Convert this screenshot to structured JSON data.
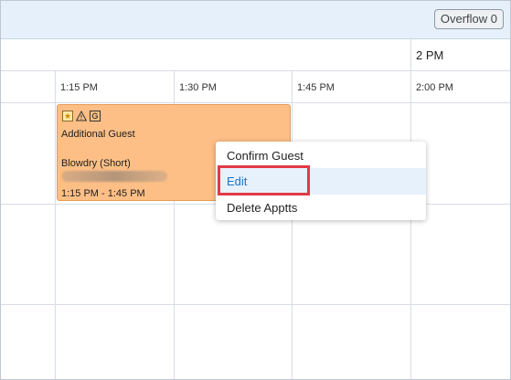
{
  "toolbar": {
    "overflow_label": "Overflow 0"
  },
  "hour_header": {
    "label": "2 PM"
  },
  "time_slots": [
    "1:15 PM",
    "1:30 PM",
    "1:45 PM",
    "2:00 PM"
  ],
  "appointment": {
    "icons": [
      "star-icon",
      "warning-icon",
      "g-badge-icon"
    ],
    "title": "Additional Guest",
    "service": "Blowdry (Short)",
    "time_range": "1:15 PM - 1:45 PM",
    "color": "#fdbf86"
  },
  "context_menu": {
    "items": [
      "Confirm Guest",
      "Edit",
      "Delete Apptts"
    ],
    "active_index": 1,
    "active_color": "#1a73c9",
    "highlight_color": "#e03a46"
  }
}
